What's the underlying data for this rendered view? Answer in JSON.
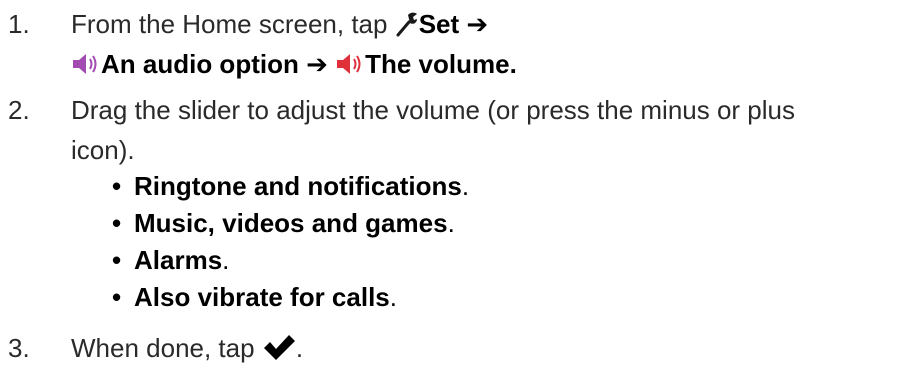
{
  "steps": [
    {
      "number": "1.",
      "line1_prefix": "From the Home screen, tap ",
      "set_label": "Set",
      "arrow": "➔",
      "audio_option_label": "An audio option",
      "volume_label": "The volume",
      "period": "."
    },
    {
      "number": "2.",
      "line1": "Drag the slider to adjust the volume (or press the minus or plus",
      "line2": "icon).",
      "bullets": [
        {
          "label": "Ringtone and notifications",
          "period": "."
        },
        {
          "label": "Music, videos and games",
          "period": "."
        },
        {
          "label": "Alarms",
          "period": "."
        },
        {
          "label": "Also vibrate for calls",
          "period": "."
        }
      ],
      "bullet_glyph": "•"
    },
    {
      "number": "3.",
      "text": "When done, tap ",
      "period": "."
    }
  ],
  "icons": {
    "settings": "wrench-icon",
    "audio_option": "speaker-icon",
    "volume": "speaker-icon",
    "done": "checkmark-icon"
  },
  "colors": {
    "speaker_purple": "#a24bb0",
    "speaker_red": "#e0313a",
    "wrench": "#1a1a1a"
  }
}
